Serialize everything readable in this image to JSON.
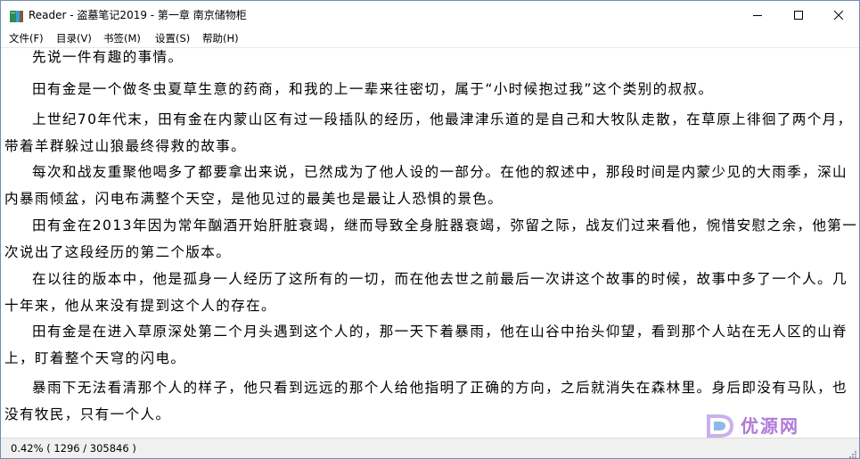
{
  "window": {
    "title": "Reader - 盗墓笔记2019 - 第一章 南京储物柜",
    "app_icon": "book-icon",
    "controls": [
      "minimize-icon",
      "maximize-icon",
      "close-icon"
    ]
  },
  "menu": {
    "items": [
      {
        "label": "文件(F)"
      },
      {
        "label": "目录(V)"
      },
      {
        "label": "书签(M)"
      },
      {
        "label": "设置(S)"
      },
      {
        "label": "帮助(H)"
      }
    ]
  },
  "content": {
    "paragraphs": [
      "先说一件有趣的事情。",
      "田有金是一个做冬虫夏草生意的药商，和我的上一辈来往密切，属于“小时候抱过我”这个类别的叔叔。",
      "上世纪70年代末，田有金在内蒙山区有过一段插队的经历，他最津津乐道的是自己和大牧队走散，在草原上徘徊了两个月，带着羊群躲过山狼最终得救的故事。",
      "每次和战友重聚他喝多了都要拿出来说，已然成为了他人设的一部分。在他的叙述中，那段时间是内蒙少见的大雨季，深山内暴雨倾盆，闪电布满整个天空，是他见过的最美也是最让人恐惧的景色。",
      "田有金在2013年因为常年酗酒开始肝脏衰竭，继而导致全身脏器衰竭，弥留之际，战友们过来看他，惋惜安慰之余，他第一次说出了这段经历的第二个版本。",
      "在以往的版本中，他是孤身一人经历了这所有的一切，而在他去世之前最后一次讲这个故事的时候，故事中多了一个人。几十年来，他从来没有提到这个人的存在。",
      "田有金是在进入草原深处第二个月头遇到这个人的，那一天下着暴雨，他在山谷中抬头仰望，看到那个人站在无人区的山脊上，盯着整个天穹的闪电。",
      "暴雨下无法看清那个人的样子，他只看到远远的那个人给他指明了正确的方向，之后就消失在森林里。身后即没有马队，也没有牧民，只有一个人。"
    ]
  },
  "watermark": {
    "text": "优源网",
    "logo": "d-logo-icon",
    "color": "#b07ad8"
  },
  "status": {
    "text": "0.42%  ( 1296 / 305846 )"
  }
}
